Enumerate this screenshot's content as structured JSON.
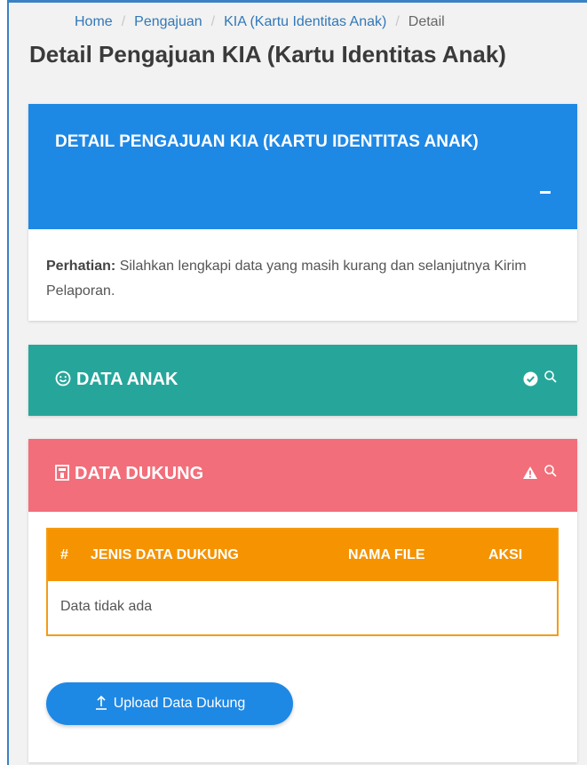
{
  "breadcrumb": {
    "items": [
      "Home",
      "Pengajuan",
      "KIA (Kartu Identitas Anak)",
      "Detail"
    ]
  },
  "page_title": "Detail Pengajuan KIA (Kartu Identitas Anak)",
  "main_card": {
    "title": "DETAIL PENGAJUAN KIA (KARTU IDENTITAS ANAK)",
    "notice_label": "Perhatian:",
    "notice_text": " Silahkan lengkapi data yang masih kurang dan selanjutnya Kirim Pelaporan.",
    "color": "#1e88e5"
  },
  "data_anak": {
    "title": "DATA ANAK",
    "icon": "smile-icon",
    "status_icon": "check-circle-icon",
    "color": "#26a69a"
  },
  "data_dukung": {
    "title": "DATA DUKUNG",
    "icon": "file-icon",
    "status_icon": "warning-icon",
    "color": "#f26e7a",
    "table": {
      "columns": [
        "#",
        "JENIS DATA DUKUNG",
        "NAMA FILE",
        "AKSI"
      ],
      "empty_text": "Data tidak ada",
      "header_color": "#f59300"
    },
    "upload_button": "Upload Data Dukung"
  }
}
